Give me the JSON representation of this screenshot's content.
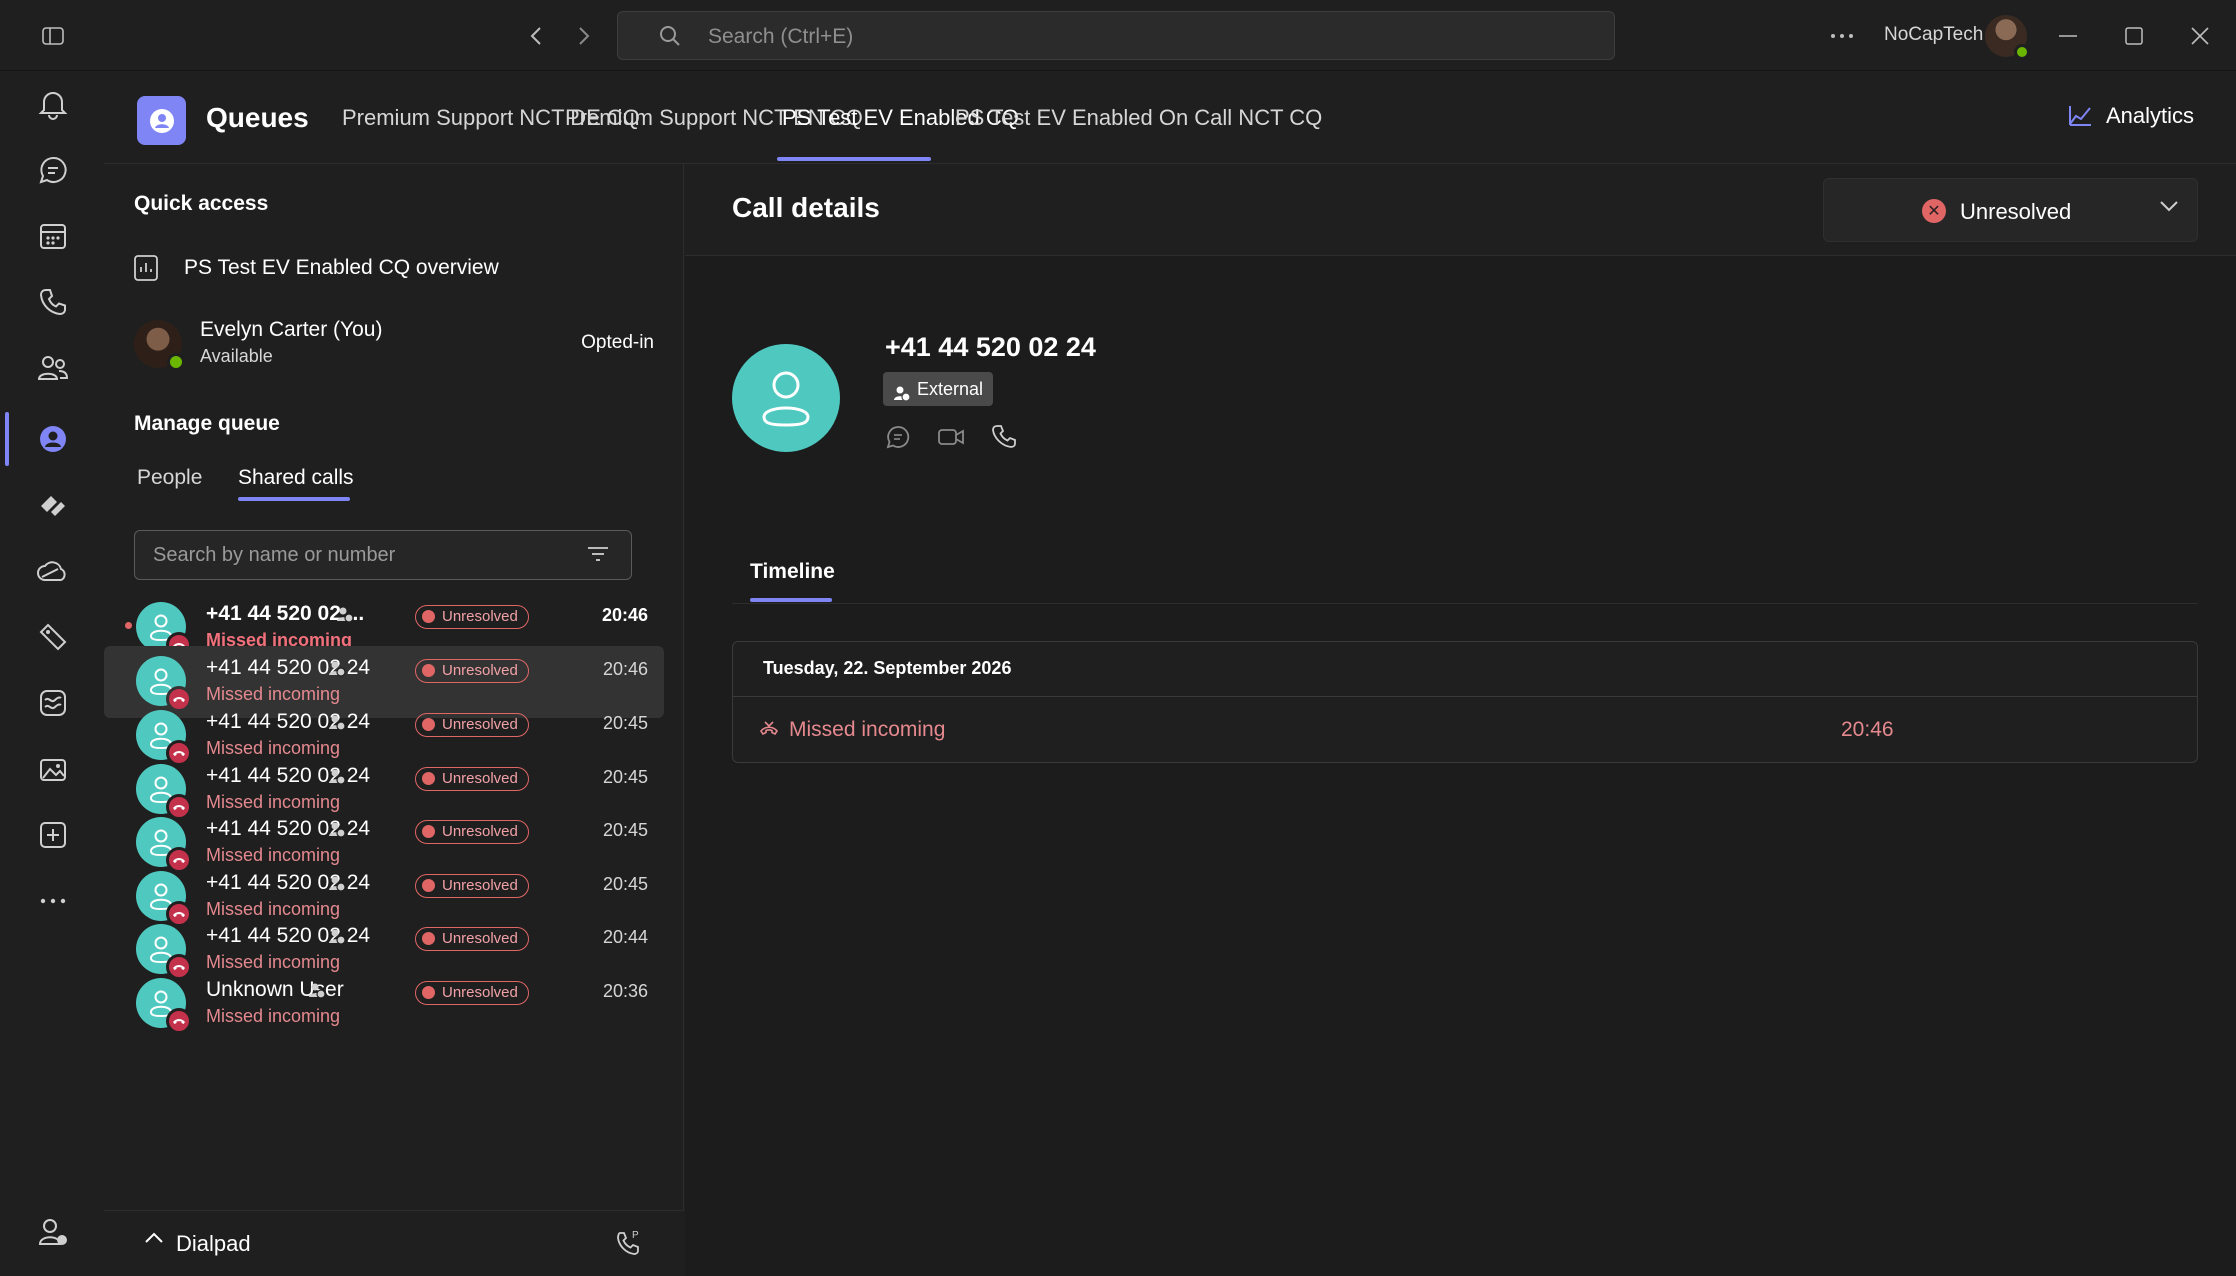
{
  "titlebar": {
    "search_placeholder": "Search (Ctrl+E)",
    "user_name": "NoCapTech"
  },
  "app": {
    "title": "Queues",
    "tabs": [
      {
        "label": "Premium Support NCT DE CQ"
      },
      {
        "label": "Premium Support NCT EN CQ"
      },
      {
        "label": "PS Test EV Enabled CQ"
      },
      {
        "label": "PS Test EV Enabled On Call NCT CQ"
      }
    ],
    "analytics_label": "Analytics"
  },
  "quick_access": {
    "title": "Quick access",
    "overview_label": "PS Test EV Enabled CQ overview",
    "agent_name": "Evelyn Carter (You)",
    "agent_status": "Available",
    "agent_optin": "Opted-in"
  },
  "manage_queue": {
    "title": "Manage queue",
    "tabs": [
      {
        "label": "People"
      },
      {
        "label": "Shared calls"
      }
    ],
    "search_placeholder": "Search by name or number"
  },
  "calls": [
    {
      "name": "+41 44 520 02 ...",
      "sub": "Missed incoming",
      "badge": "Unresolved",
      "time": "20:46"
    },
    {
      "name": "+41 44 520 02 24",
      "sub": "Missed incoming",
      "badge": "Unresolved",
      "time": "20:46"
    },
    {
      "name": "+41 44 520 02 24",
      "sub": "Missed incoming",
      "badge": "Unresolved",
      "time": "20:45"
    },
    {
      "name": "+41 44 520 02 24",
      "sub": "Missed incoming",
      "badge": "Unresolved",
      "time": "20:45"
    },
    {
      "name": "+41 44 520 02 24",
      "sub": "Missed incoming",
      "badge": "Unresolved",
      "time": "20:45"
    },
    {
      "name": "+41 44 520 02 24",
      "sub": "Missed incoming",
      "badge": "Unresolved",
      "time": "20:45"
    },
    {
      "name": "+41 44 520 02 24",
      "sub": "Missed incoming",
      "badge": "Unresolved",
      "time": "20:44"
    },
    {
      "name": "Unknown User",
      "sub": "Missed incoming",
      "badge": "Unresolved",
      "time": "20:36"
    }
  ],
  "dialpad": {
    "label": "Dialpad"
  },
  "details": {
    "title": "Call details",
    "status": "Unresolved",
    "number": "+41 44 520 02 24",
    "contact_type": "External",
    "timeline_tab": "Timeline",
    "timeline_date": "Tuesday, 22. September 2026",
    "event_label": "Missed incoming",
    "event_time": "20:46"
  },
  "colors": {
    "accent": "#7f85f5",
    "missed": "#e5898f",
    "avatar": "#4fc9c0",
    "available": "#6bb700"
  }
}
